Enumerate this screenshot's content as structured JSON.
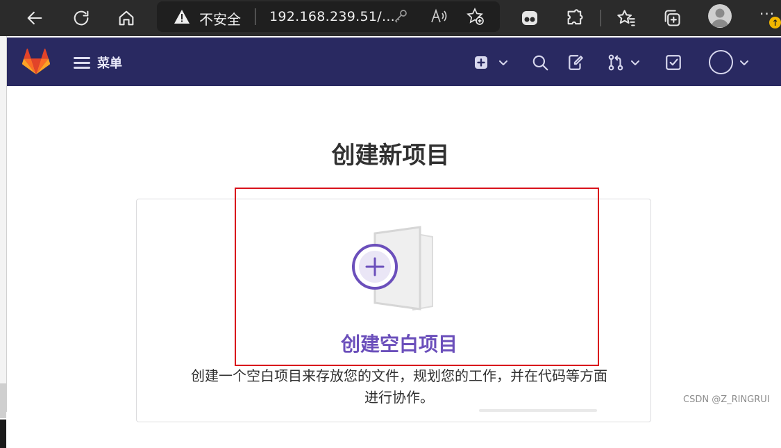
{
  "browser": {
    "security_label": "不安全",
    "url": "192.168.239.51/...",
    "more_label": "···",
    "update_badge": "↑"
  },
  "gitlab_header": {
    "menu_label": "菜单",
    "brand_color": "#292961"
  },
  "page": {
    "title": "创建新项目",
    "card": {
      "title": "创建空白项目",
      "description": "创建一个空白项目来存放您的文件，规划您的工作，并在代码等方面进行协作。"
    }
  },
  "watermark": "CSDN @Z_RINGRUI",
  "colors": {
    "accent": "#6b4fbb",
    "highlight_box": "#d9121b"
  }
}
